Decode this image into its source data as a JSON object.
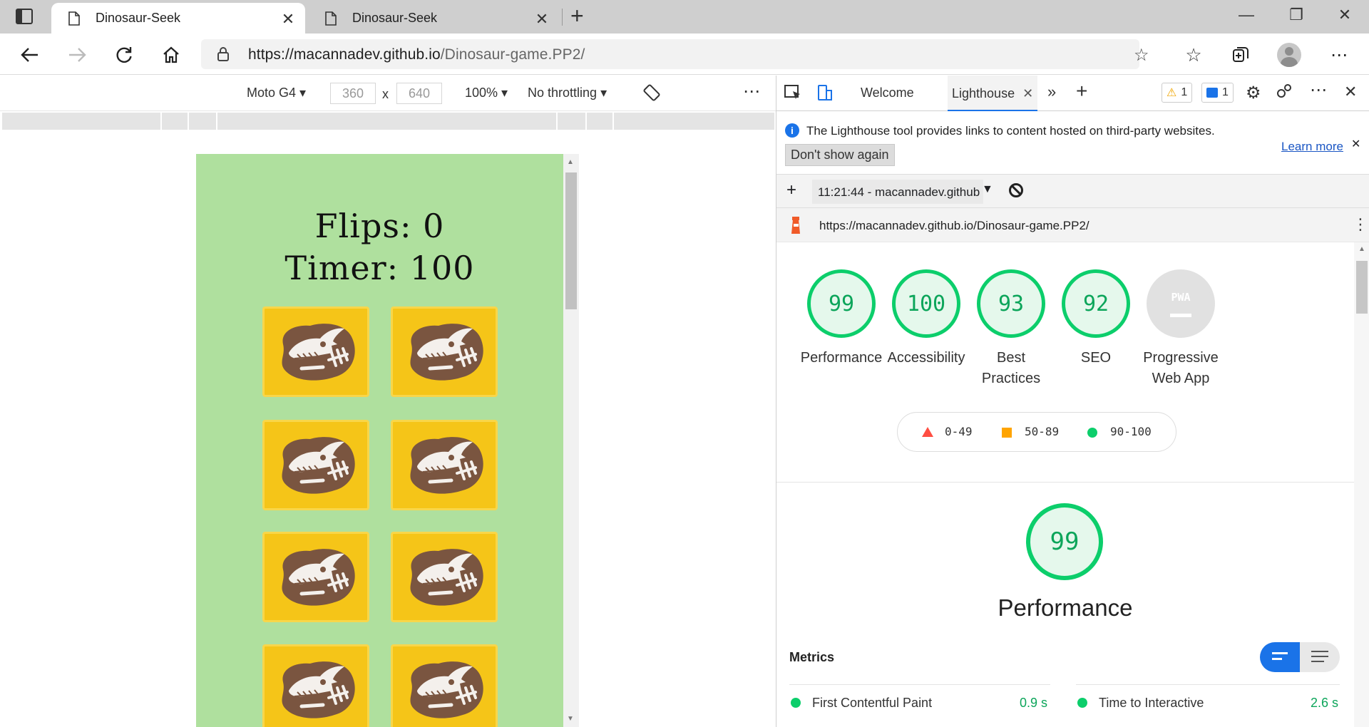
{
  "browser": {
    "tabs": [
      {
        "title": "Dinosaur-Seek",
        "active": true
      },
      {
        "title": "Dinosaur-Seek",
        "active": false
      }
    ],
    "url_host": "https://macannadev.github.io",
    "url_path": "/Dinosaur-game.PP2/"
  },
  "device_toolbar": {
    "device": "Moto G4",
    "width": "360",
    "times": "x",
    "height": "640",
    "zoom": "100%",
    "throttling": "No throttling",
    "more": "⋯"
  },
  "game": {
    "flips_label": "Flips: 0",
    "timer_label": "Timer: 100",
    "card_count": 8
  },
  "devtools": {
    "tabs": {
      "welcome": "Welcome",
      "lighthouse": "Lighthouse"
    },
    "warnings_count": "1",
    "messages_count": "1",
    "info_text": "The Lighthouse tool provides links to content hosted on third-party websites.",
    "learn_more": "Learn more",
    "dont_show": "Don't show again",
    "report_select": "11:21:44 - macannadev.github",
    "report_url": "https://macannadev.github.io/Dinosaur-game.PP2/",
    "scores": [
      {
        "value": "99",
        "label": "Performance"
      },
      {
        "value": "100",
        "label": "Accessibility"
      },
      {
        "value": "93",
        "label": "Best Practices"
      },
      {
        "value": "92",
        "label": "SEO"
      },
      {
        "value": "PWA",
        "label": "Progressive Web App"
      }
    ],
    "legend": {
      "low": "0-49",
      "mid": "50-89",
      "high": "90-100"
    },
    "performance_score": "99",
    "performance_title": "Performance",
    "metrics_title": "Metrics",
    "metrics": [
      {
        "name": "First Contentful Paint",
        "value": "0.9 s"
      },
      {
        "name": "Time to Interactive",
        "value": "2.6 s"
      }
    ],
    "colors": {
      "pass": "#0cce6b",
      "average": "#ffa400",
      "fail": "#ff4e42",
      "accent": "#1a73e8"
    }
  }
}
